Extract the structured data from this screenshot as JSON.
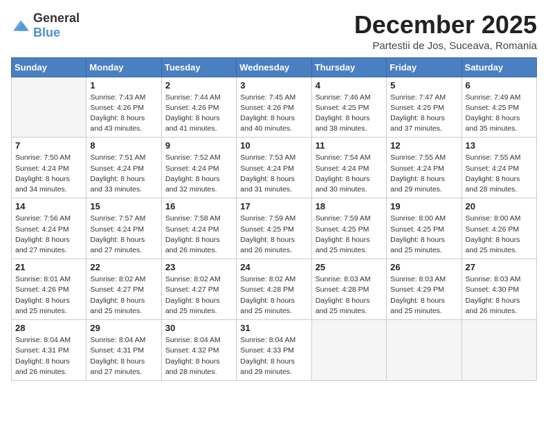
{
  "header": {
    "logo": {
      "general": "General",
      "blue": "Blue"
    },
    "title": "December 2025",
    "subtitle": "Partestii de Jos, Suceava, Romania"
  },
  "calendar": {
    "days_of_week": [
      "Sunday",
      "Monday",
      "Tuesday",
      "Wednesday",
      "Thursday",
      "Friday",
      "Saturday"
    ],
    "weeks": [
      [
        {
          "day": "",
          "empty": true
        },
        {
          "day": "1",
          "sunrise": "Sunrise: 7:43 AM",
          "sunset": "Sunset: 4:26 PM",
          "daylight": "Daylight: 8 hours and 43 minutes."
        },
        {
          "day": "2",
          "sunrise": "Sunrise: 7:44 AM",
          "sunset": "Sunset: 4:26 PM",
          "daylight": "Daylight: 8 hours and 41 minutes."
        },
        {
          "day": "3",
          "sunrise": "Sunrise: 7:45 AM",
          "sunset": "Sunset: 4:26 PM",
          "daylight": "Daylight: 8 hours and 40 minutes."
        },
        {
          "day": "4",
          "sunrise": "Sunrise: 7:46 AM",
          "sunset": "Sunset: 4:25 PM",
          "daylight": "Daylight: 8 hours and 38 minutes."
        },
        {
          "day": "5",
          "sunrise": "Sunrise: 7:47 AM",
          "sunset": "Sunset: 4:25 PM",
          "daylight": "Daylight: 8 hours and 37 minutes."
        },
        {
          "day": "6",
          "sunrise": "Sunrise: 7:49 AM",
          "sunset": "Sunset: 4:25 PM",
          "daylight": "Daylight: 8 hours and 35 minutes."
        }
      ],
      [
        {
          "day": "7",
          "sunrise": "Sunrise: 7:50 AM",
          "sunset": "Sunset: 4:24 PM",
          "daylight": "Daylight: 8 hours and 34 minutes."
        },
        {
          "day": "8",
          "sunrise": "Sunrise: 7:51 AM",
          "sunset": "Sunset: 4:24 PM",
          "daylight": "Daylight: 8 hours and 33 minutes."
        },
        {
          "day": "9",
          "sunrise": "Sunrise: 7:52 AM",
          "sunset": "Sunset: 4:24 PM",
          "daylight": "Daylight: 8 hours and 32 minutes."
        },
        {
          "day": "10",
          "sunrise": "Sunrise: 7:53 AM",
          "sunset": "Sunset: 4:24 PM",
          "daylight": "Daylight: 8 hours and 31 minutes."
        },
        {
          "day": "11",
          "sunrise": "Sunrise: 7:54 AM",
          "sunset": "Sunset: 4:24 PM",
          "daylight": "Daylight: 8 hours and 30 minutes."
        },
        {
          "day": "12",
          "sunrise": "Sunrise: 7:55 AM",
          "sunset": "Sunset: 4:24 PM",
          "daylight": "Daylight: 8 hours and 29 minutes."
        },
        {
          "day": "13",
          "sunrise": "Sunrise: 7:55 AM",
          "sunset": "Sunset: 4:24 PM",
          "daylight": "Daylight: 8 hours and 28 minutes."
        }
      ],
      [
        {
          "day": "14",
          "sunrise": "Sunrise: 7:56 AM",
          "sunset": "Sunset: 4:24 PM",
          "daylight": "Daylight: 8 hours and 27 minutes."
        },
        {
          "day": "15",
          "sunrise": "Sunrise: 7:57 AM",
          "sunset": "Sunset: 4:24 PM",
          "daylight": "Daylight: 8 hours and 27 minutes."
        },
        {
          "day": "16",
          "sunrise": "Sunrise: 7:58 AM",
          "sunset": "Sunset: 4:24 PM",
          "daylight": "Daylight: 8 hours and 26 minutes."
        },
        {
          "day": "17",
          "sunrise": "Sunrise: 7:59 AM",
          "sunset": "Sunset: 4:25 PM",
          "daylight": "Daylight: 8 hours and 26 minutes."
        },
        {
          "day": "18",
          "sunrise": "Sunrise: 7:59 AM",
          "sunset": "Sunset: 4:25 PM",
          "daylight": "Daylight: 8 hours and 25 minutes."
        },
        {
          "day": "19",
          "sunrise": "Sunrise: 8:00 AM",
          "sunset": "Sunset: 4:25 PM",
          "daylight": "Daylight: 8 hours and 25 minutes."
        },
        {
          "day": "20",
          "sunrise": "Sunrise: 8:00 AM",
          "sunset": "Sunset: 4:26 PM",
          "daylight": "Daylight: 8 hours and 25 minutes."
        }
      ],
      [
        {
          "day": "21",
          "sunrise": "Sunrise: 8:01 AM",
          "sunset": "Sunset: 4:26 PM",
          "daylight": "Daylight: 8 hours and 25 minutes."
        },
        {
          "day": "22",
          "sunrise": "Sunrise: 8:02 AM",
          "sunset": "Sunset: 4:27 PM",
          "daylight": "Daylight: 8 hours and 25 minutes."
        },
        {
          "day": "23",
          "sunrise": "Sunrise: 8:02 AM",
          "sunset": "Sunset: 4:27 PM",
          "daylight": "Daylight: 8 hours and 25 minutes."
        },
        {
          "day": "24",
          "sunrise": "Sunrise: 8:02 AM",
          "sunset": "Sunset: 4:28 PM",
          "daylight": "Daylight: 8 hours and 25 minutes."
        },
        {
          "day": "25",
          "sunrise": "Sunrise: 8:03 AM",
          "sunset": "Sunset: 4:28 PM",
          "daylight": "Daylight: 8 hours and 25 minutes."
        },
        {
          "day": "26",
          "sunrise": "Sunrise: 8:03 AM",
          "sunset": "Sunset: 4:29 PM",
          "daylight": "Daylight: 8 hours and 25 minutes."
        },
        {
          "day": "27",
          "sunrise": "Sunrise: 8:03 AM",
          "sunset": "Sunset: 4:30 PM",
          "daylight": "Daylight: 8 hours and 26 minutes."
        }
      ],
      [
        {
          "day": "28",
          "sunrise": "Sunrise: 8:04 AM",
          "sunset": "Sunset: 4:31 PM",
          "daylight": "Daylight: 8 hours and 26 minutes."
        },
        {
          "day": "29",
          "sunrise": "Sunrise: 8:04 AM",
          "sunset": "Sunset: 4:31 PM",
          "daylight": "Daylight: 8 hours and 27 minutes."
        },
        {
          "day": "30",
          "sunrise": "Sunrise: 8:04 AM",
          "sunset": "Sunset: 4:32 PM",
          "daylight": "Daylight: 8 hours and 28 minutes."
        },
        {
          "day": "31",
          "sunrise": "Sunrise: 8:04 AM",
          "sunset": "Sunset: 4:33 PM",
          "daylight": "Daylight: 8 hours and 29 minutes."
        },
        {
          "day": "",
          "empty": true
        },
        {
          "day": "",
          "empty": true
        },
        {
          "day": "",
          "empty": true
        }
      ]
    ]
  }
}
